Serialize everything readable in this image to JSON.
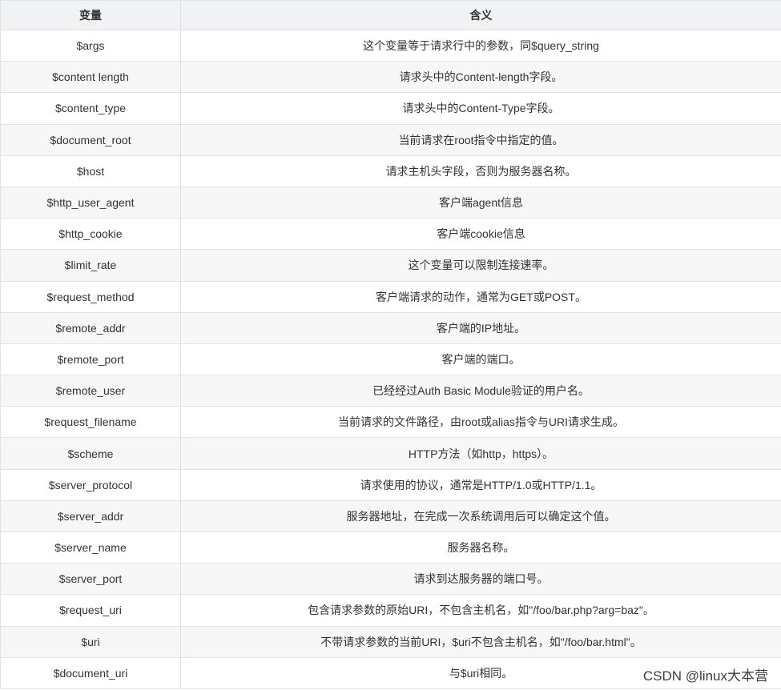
{
  "table": {
    "headers": [
      "变量",
      "含义"
    ],
    "rows": [
      [
        "$args",
        "这个变量等于请求行中的参数，同$query_string"
      ],
      [
        "$content length",
        "请求头中的Content-length字段。"
      ],
      [
        "$content_type",
        "请求头中的Content-Type字段。"
      ],
      [
        "$document_root",
        "当前请求在root指令中指定的值。"
      ],
      [
        "$host",
        "请求主机头字段，否则为服务器名称。"
      ],
      [
        "$http_user_agent",
        "客户端agent信息"
      ],
      [
        "$http_cookie",
        "客户端cookie信息"
      ],
      [
        "$limit_rate",
        "这个变量可以限制连接速率。"
      ],
      [
        "$request_method",
        "客户端请求的动作，通常为GET或POST。"
      ],
      [
        "$remote_addr",
        "客户端的IP地址。"
      ],
      [
        "$remote_port",
        "客户端的端口。"
      ],
      [
        "$remote_user",
        "已经经过Auth Basic Module验证的用户名。"
      ],
      [
        "$request_filename",
        "当前请求的文件路径，由root或alias指令与URI请求生成。"
      ],
      [
        "$scheme",
        "HTTP方法（如http，https）。"
      ],
      [
        "$server_protocol",
        "请求使用的协议，通常是HTTP/1.0或HTTP/1.1。"
      ],
      [
        "$server_addr",
        "服务器地址，在完成一次系统调用后可以确定这个值。"
      ],
      [
        "$server_name",
        "服务器名称。"
      ],
      [
        "$server_port",
        "请求到达服务器的端口号。"
      ],
      [
        "$request_uri",
        "包含请求参数的原始URI，不包含主机名，如\"/foo/bar.php?arg=baz\"。"
      ],
      [
        "$uri",
        "不带请求参数的当前URI，$uri不包含主机名，如\"/foo/bar.html\"。"
      ],
      [
        "$document_uri",
        "与$uri相同。"
      ]
    ]
  },
  "watermark": "CSDN @linux大本营"
}
